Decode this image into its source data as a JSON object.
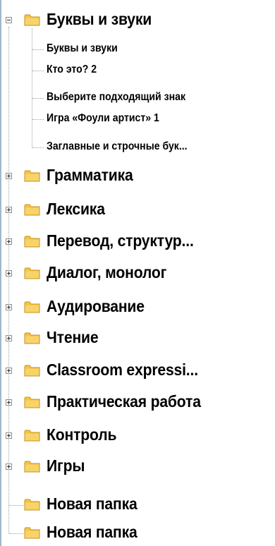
{
  "tree": {
    "open_folder": {
      "label": "Буквы и звуки",
      "children": [
        "Буквы и звуки",
        "Кто это? 2",
        "Выберите подходящий знак",
        "Игра «Фоули артист» 1",
        "Заглавные и строчные бук..."
      ]
    },
    "folders": [
      "Грамматика",
      "Лексика",
      "Перевод, структур...",
      "Диалог, монолог",
      "Аудирование",
      "Чтение",
      "Classroom expressi...",
      "Практическая работа",
      "Контроль",
      "Игры"
    ],
    "empty_folders": [
      "Новая папка",
      "Новая папка"
    ]
  },
  "icons": {
    "folder_icon": "folder-icon",
    "expand_icon": "plus-box-icon",
    "collapse_icon": "minus-box-icon"
  },
  "colors": {
    "folder_fill": "#f5c542",
    "folder_stroke": "#c8901a",
    "tree_lines": "#a0a0a0",
    "left_border": "#9fb8cf"
  }
}
